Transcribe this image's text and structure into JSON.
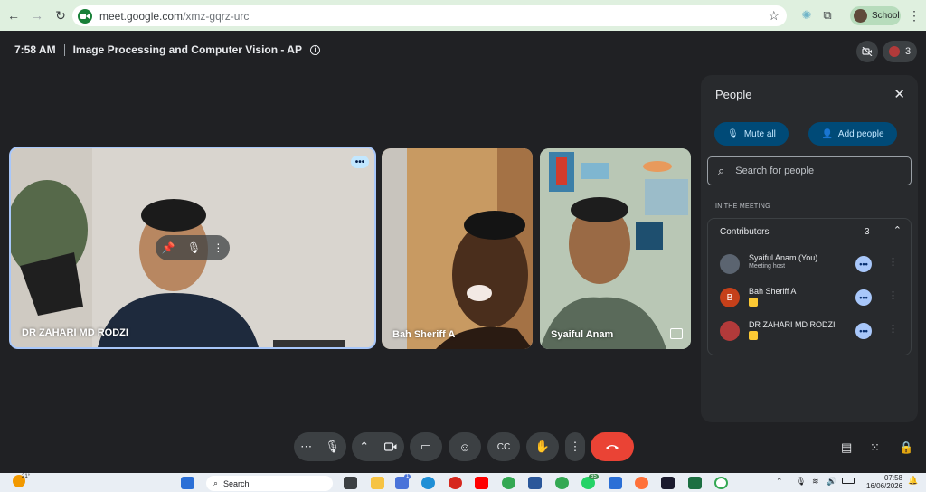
{
  "browser": {
    "url_host": "meet.google.com",
    "url_path": "/xmz-gqrz-urc",
    "profile_label": "School"
  },
  "meeting": {
    "time": "7:58 AM",
    "title": "Image Processing and Computer Vision - AP",
    "participant_count": "3"
  },
  "tiles": [
    {
      "name": "DR ZAHARI MD RODZI"
    },
    {
      "name": "Bah Sheriff A"
    },
    {
      "name": "Syaiful Anam"
    }
  ],
  "people_panel": {
    "title": "People",
    "mute_all_label": "Mute all",
    "add_people_label": "Add people",
    "search_placeholder": "Search for people",
    "section_label": "IN THE MEETING",
    "group_label": "Contributors",
    "group_count": "3",
    "participants": [
      {
        "name": "Syaiful Anam (You)",
        "role": "Meeting host",
        "avatar_color": "#5b6470"
      },
      {
        "name": "Bah Sheriff A",
        "role": "",
        "avatar_letter": "B",
        "avatar_color": "#c5401a"
      },
      {
        "name": "DR ZAHARI MD RODZI",
        "role": "",
        "avatar_color": "#b23a3a"
      }
    ]
  },
  "taskbar": {
    "weather": "21°",
    "search_label": "Search",
    "badge_a": "1",
    "badge_b": "65",
    "clock_time": "07:58",
    "clock_date": "16/06/2026"
  },
  "colors": {
    "end_call": "#ea4335",
    "accent": "#a8c7fa",
    "chrome_green": "#dff0df"
  }
}
